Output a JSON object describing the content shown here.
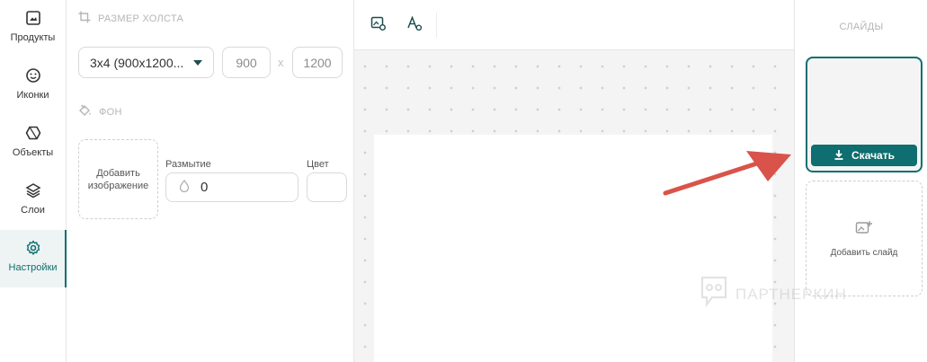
{
  "nav": {
    "items": [
      {
        "label": "Продукты",
        "icon": "image-frame-icon",
        "active": false
      },
      {
        "label": "Иконки",
        "icon": "smiley-icon",
        "active": false
      },
      {
        "label": "Объекты",
        "icon": "hexagon-icon",
        "active": false
      },
      {
        "label": "Слои",
        "icon": "layers-icon",
        "active": false
      },
      {
        "label": "Настройки",
        "icon": "gear-icon",
        "active": true
      }
    ]
  },
  "settings": {
    "canvas_size_title": "РАЗМЕР ХОЛСТА",
    "size_select_value": "3x4 (900x1200...",
    "width_value": "900",
    "times_sign": "x",
    "height_value": "1200",
    "background_title": "ФОН",
    "add_image_label": "Добавить изображение",
    "blur_label": "Размытие",
    "blur_value": "0",
    "color_label": "Цвет"
  },
  "slides": {
    "title": "СЛАЙДЫ",
    "download_label": "Скачать",
    "add_slide_label": "Добавить слайд"
  },
  "watermark": {
    "text": "ПАРТНЕРКИН"
  },
  "colors": {
    "accent": "#0f6e6f",
    "arrow": "#d9534a"
  }
}
